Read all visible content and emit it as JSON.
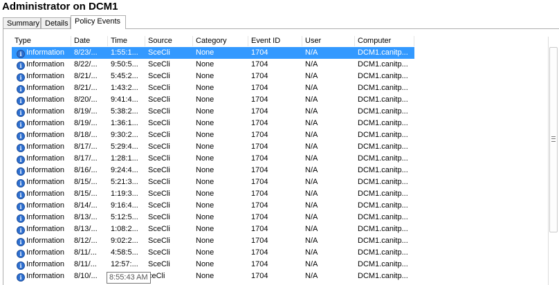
{
  "window": {
    "title": "Administrator on DCM1"
  },
  "tabs": [
    {
      "label": "Summary",
      "active": false
    },
    {
      "label": "Details",
      "active": false
    },
    {
      "label": "Policy Events",
      "active": true
    }
  ],
  "table": {
    "columns": [
      "Type",
      "Date",
      "Time",
      "Source",
      "Category",
      "Event ID",
      "User",
      "Computer"
    ],
    "rows": [
      [
        "Information",
        "8/23/...",
        "1:55:1...",
        "SceCli",
        "None",
        "1704",
        "N/A",
        "DCM1.canitp..."
      ],
      [
        "Information",
        "8/22/...",
        "9:50:5...",
        "SceCli",
        "None",
        "1704",
        "N/A",
        "DCM1.canitp..."
      ],
      [
        "Information",
        "8/21/...",
        "5:45:2...",
        "SceCli",
        "None",
        "1704",
        "N/A",
        "DCM1.canitp..."
      ],
      [
        "Information",
        "8/21/...",
        "1:43:2...",
        "SceCli",
        "None",
        "1704",
        "N/A",
        "DCM1.canitp..."
      ],
      [
        "Information",
        "8/20/...",
        "9:41:4...",
        "SceCli",
        "None",
        "1704",
        "N/A",
        "DCM1.canitp..."
      ],
      [
        "Information",
        "8/19/...",
        "5:38:2...",
        "SceCli",
        "None",
        "1704",
        "N/A",
        "DCM1.canitp..."
      ],
      [
        "Information",
        "8/19/...",
        "1:36:1...",
        "SceCli",
        "None",
        "1704",
        "N/A",
        "DCM1.canitp..."
      ],
      [
        "Information",
        "8/18/...",
        "9:30:2...",
        "SceCli",
        "None",
        "1704",
        "N/A",
        "DCM1.canitp..."
      ],
      [
        "Information",
        "8/17/...",
        "5:29:4...",
        "SceCli",
        "None",
        "1704",
        "N/A",
        "DCM1.canitp..."
      ],
      [
        "Information",
        "8/17/...",
        "1:28:1...",
        "SceCli",
        "None",
        "1704",
        "N/A",
        "DCM1.canitp..."
      ],
      [
        "Information",
        "8/16/...",
        "9:24:4...",
        "SceCli",
        "None",
        "1704",
        "N/A",
        "DCM1.canitp..."
      ],
      [
        "Information",
        "8/15/...",
        "5:21:3...",
        "SceCli",
        "None",
        "1704",
        "N/A",
        "DCM1.canitp..."
      ],
      [
        "Information",
        "8/15/...",
        "1:19:3...",
        "SceCli",
        "None",
        "1704",
        "N/A",
        "DCM1.canitp..."
      ],
      [
        "Information",
        "8/14/...",
        "9:16:4...",
        "SceCli",
        "None",
        "1704",
        "N/A",
        "DCM1.canitp..."
      ],
      [
        "Information",
        "8/13/...",
        "5:12:5...",
        "SceCli",
        "None",
        "1704",
        "N/A",
        "DCM1.canitp..."
      ],
      [
        "Information",
        "8/13/...",
        "1:08:2...",
        "SceCli",
        "None",
        "1704",
        "N/A",
        "DCM1.canitp..."
      ],
      [
        "Information",
        "8/12/...",
        "9:02:2...",
        "SceCli",
        "None",
        "1704",
        "N/A",
        "DCM1.canitp..."
      ],
      [
        "Information",
        "8/11/...",
        "4:58:5...",
        "SceCli",
        "None",
        "1704",
        "N/A",
        "DCM1.canitp..."
      ],
      [
        "Information",
        "8/11/...",
        "12:57:...",
        "SceCli",
        "None",
        "1704",
        "N/A",
        "DCM1.canitp..."
      ],
      [
        "Information",
        "8/10/...",
        "",
        "ceCli",
        "None",
        "1704",
        "N/A",
        "DCM1.canitp..."
      ]
    ],
    "selected_row": 0,
    "row_icon": "information-icon"
  },
  "tooltip": {
    "text": "8:55:43 AM"
  },
  "colors": {
    "selection": "#3399ff",
    "info_icon": "#2d6fd0"
  }
}
